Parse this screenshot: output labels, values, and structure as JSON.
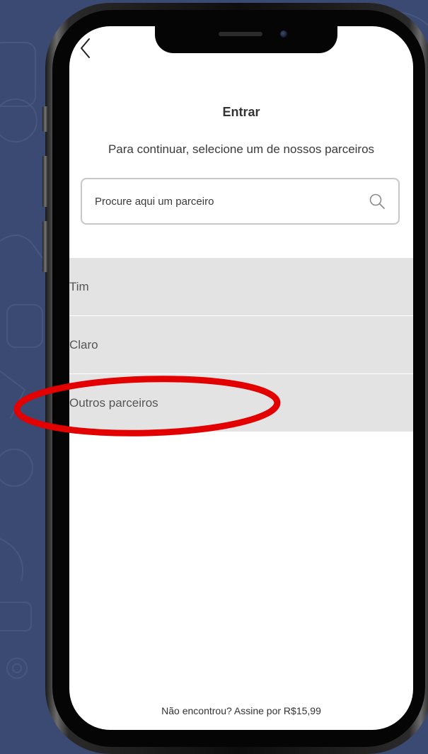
{
  "header": {
    "title": "Entrar",
    "subtitle": "Para continuar, selecione um de nossos parceiros"
  },
  "search": {
    "placeholder": "Procure aqui um parceiro",
    "value": ""
  },
  "partners": [
    {
      "label": "Tim"
    },
    {
      "label": "Claro"
    },
    {
      "label": "Outros parceiros"
    }
  ],
  "footer": {
    "link_text": "Não encontrou? Assine por R$15,99"
  },
  "icons": {
    "back": "chevron-left-icon",
    "search": "search-icon"
  },
  "colors": {
    "background": "#3b4a72",
    "list_item_bg": "#e3e3e3",
    "highlight": "#e30000"
  }
}
